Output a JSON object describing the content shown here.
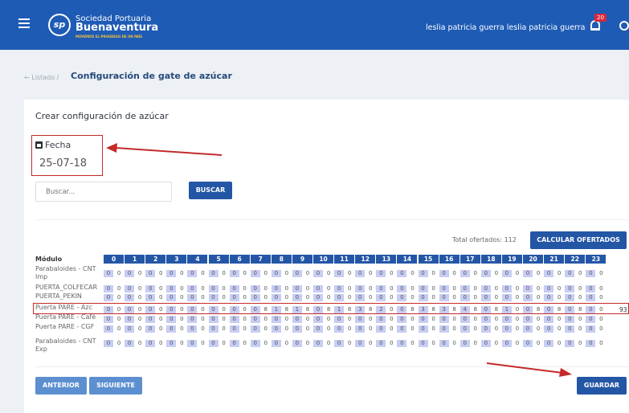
{
  "header": {
    "logo_text": "sp",
    "brand_line1": "Sociedad Portuaria",
    "brand_line2": "Buenaventura",
    "brand_tagline": "MOVEMOS EL PROGRESO DE UN PAÍS",
    "user_name": "leslia patricia guerra leslia patricia guerra",
    "notifications_count": "20",
    "colors": {
      "bar": "#1e5bb5",
      "badge": "#d9273a"
    }
  },
  "breadcrumb": {
    "back_label": "← Listado /",
    "title": "Configuración de gate de azúcar"
  },
  "form": {
    "card_title": "Crear configuración de azúcar",
    "fecha_label": "Fecha",
    "fecha_value": "25-07-18",
    "search_placeholder": "Buscar...",
    "buscar_label": "BUSCAR",
    "total_label": "Total ofertados: 112",
    "calc_label": "CALCULAR OFERTADOS"
  },
  "grid": {
    "header_label": "Módulo",
    "hours": [
      "0",
      "1",
      "2",
      "3",
      "4",
      "5",
      "6",
      "7",
      "8",
      "9",
      "10",
      "11",
      "12",
      "13",
      "14",
      "15",
      "16",
      "17",
      "18",
      "19",
      "20",
      "21",
      "22",
      "23"
    ],
    "rows": [
      {
        "label": "Parabaloides - CNT Imp",
        "values": [
          "0",
          "0",
          "0",
          "0",
          "0",
          "0",
          "0",
          "0",
          "0",
          "0",
          "0",
          "0",
          "0",
          "0",
          "0",
          "0",
          "0",
          "0",
          "0",
          "0",
          "0",
          "0",
          "0",
          "0",
          "0",
          "0",
          "0",
          "0",
          "0",
          "0",
          "0",
          "0",
          "0",
          "0",
          "0",
          "0",
          "0",
          "0",
          "0",
          "0",
          "0",
          "0",
          "0",
          "0",
          "0",
          "0",
          "0",
          "0"
        ],
        "total": ""
      },
      {
        "label": "PUERTA_COLFECAR",
        "values": [
          "0",
          "0",
          "0",
          "0",
          "0",
          "0",
          "0",
          "0",
          "0",
          "0",
          "0",
          "0",
          "0",
          "0",
          "0",
          "0",
          "0",
          "0",
          "0",
          "0",
          "0",
          "0",
          "0",
          "0",
          "0",
          "0",
          "0",
          "0",
          "0",
          "0",
          "0",
          "0",
          "0",
          "0",
          "0",
          "0",
          "0",
          "0",
          "0",
          "0",
          "0",
          "0",
          "0",
          "0",
          "0",
          "0",
          "0",
          "0"
        ],
        "total": ""
      },
      {
        "label": "PUERTA_PEKIN",
        "values": [
          "0",
          "0",
          "0",
          "0",
          "0",
          "0",
          "0",
          "0",
          "0",
          "0",
          "0",
          "0",
          "0",
          "0",
          "0",
          "0",
          "0",
          "0",
          "0",
          "0",
          "0",
          "0",
          "0",
          "0",
          "0",
          "0",
          "0",
          "0",
          "0",
          "0",
          "0",
          "0",
          "0",
          "0",
          "0",
          "0",
          "0",
          "0",
          "0",
          "0",
          "0",
          "0",
          "0",
          "0",
          "0",
          "0",
          "0",
          "0"
        ],
        "total": ""
      },
      {
        "label": "Puerta PARE - Azc",
        "values": [
          "0",
          "0",
          "0",
          "0",
          "0",
          "0",
          "0",
          "0",
          "0",
          "0",
          "0",
          "0",
          "0",
          "0",
          "0",
          "8",
          "1",
          "8",
          "1",
          "8",
          "0",
          "8",
          "1",
          "8",
          "3",
          "8",
          "2",
          "0",
          "0",
          "8",
          "3",
          "8",
          "3",
          "8",
          "4",
          "8",
          "0",
          "8",
          "1",
          "0",
          "0",
          "8",
          "0",
          "8",
          "0",
          "8",
          "0",
          "0"
        ],
        "total": "93"
      },
      {
        "label": "Puerta PARE - Café",
        "values": [
          "0",
          "0",
          "0",
          "0",
          "0",
          "0",
          "0",
          "0",
          "0",
          "0",
          "0",
          "0",
          "0",
          "0",
          "0",
          "0",
          "0",
          "0",
          "0",
          "0",
          "0",
          "0",
          "0",
          "0",
          "0",
          "0",
          "0",
          "0",
          "0",
          "0",
          "0",
          "0",
          "0",
          "0",
          "0",
          "0",
          "0",
          "0",
          "0",
          "0",
          "0",
          "0",
          "0",
          "0",
          "0",
          "0",
          "0",
          "0"
        ],
        "total": ""
      },
      {
        "label": "Puerta PARE - CGF",
        "values": [
          "0",
          "0",
          "0",
          "0",
          "0",
          "0",
          "0",
          "0",
          "0",
          "0",
          "0",
          "0",
          "0",
          "0",
          "0",
          "0",
          "0",
          "0",
          "0",
          "0",
          "0",
          "0",
          "0",
          "0",
          "0",
          "0",
          "0",
          "0",
          "0",
          "0",
          "0",
          "0",
          "0",
          "0",
          "0",
          "0",
          "0",
          "0",
          "0",
          "0",
          "0",
          "0",
          "0",
          "0",
          "0",
          "0",
          "0",
          "0"
        ],
        "total": ""
      },
      {
        "label": "Parabaloides - CNT Exp",
        "values": [
          "0",
          "0",
          "0",
          "0",
          "0",
          "0",
          "0",
          "0",
          "0",
          "0",
          "0",
          "0",
          "0",
          "0",
          "0",
          "0",
          "0",
          "0",
          "0",
          "0",
          "0",
          "0",
          "0",
          "0",
          "0",
          "0",
          "0",
          "0",
          "0",
          "0",
          "0",
          "0",
          "0",
          "0",
          "0",
          "0",
          "0",
          "0",
          "0",
          "0",
          "0",
          "0",
          "0",
          "0",
          "0",
          "0",
          "0",
          "0"
        ],
        "total": ""
      }
    ]
  },
  "footer": {
    "anterior_label": "ANTERIOR",
    "siguiente_label": "SIGUIENTE",
    "guardar_label": "GUARDAR"
  }
}
